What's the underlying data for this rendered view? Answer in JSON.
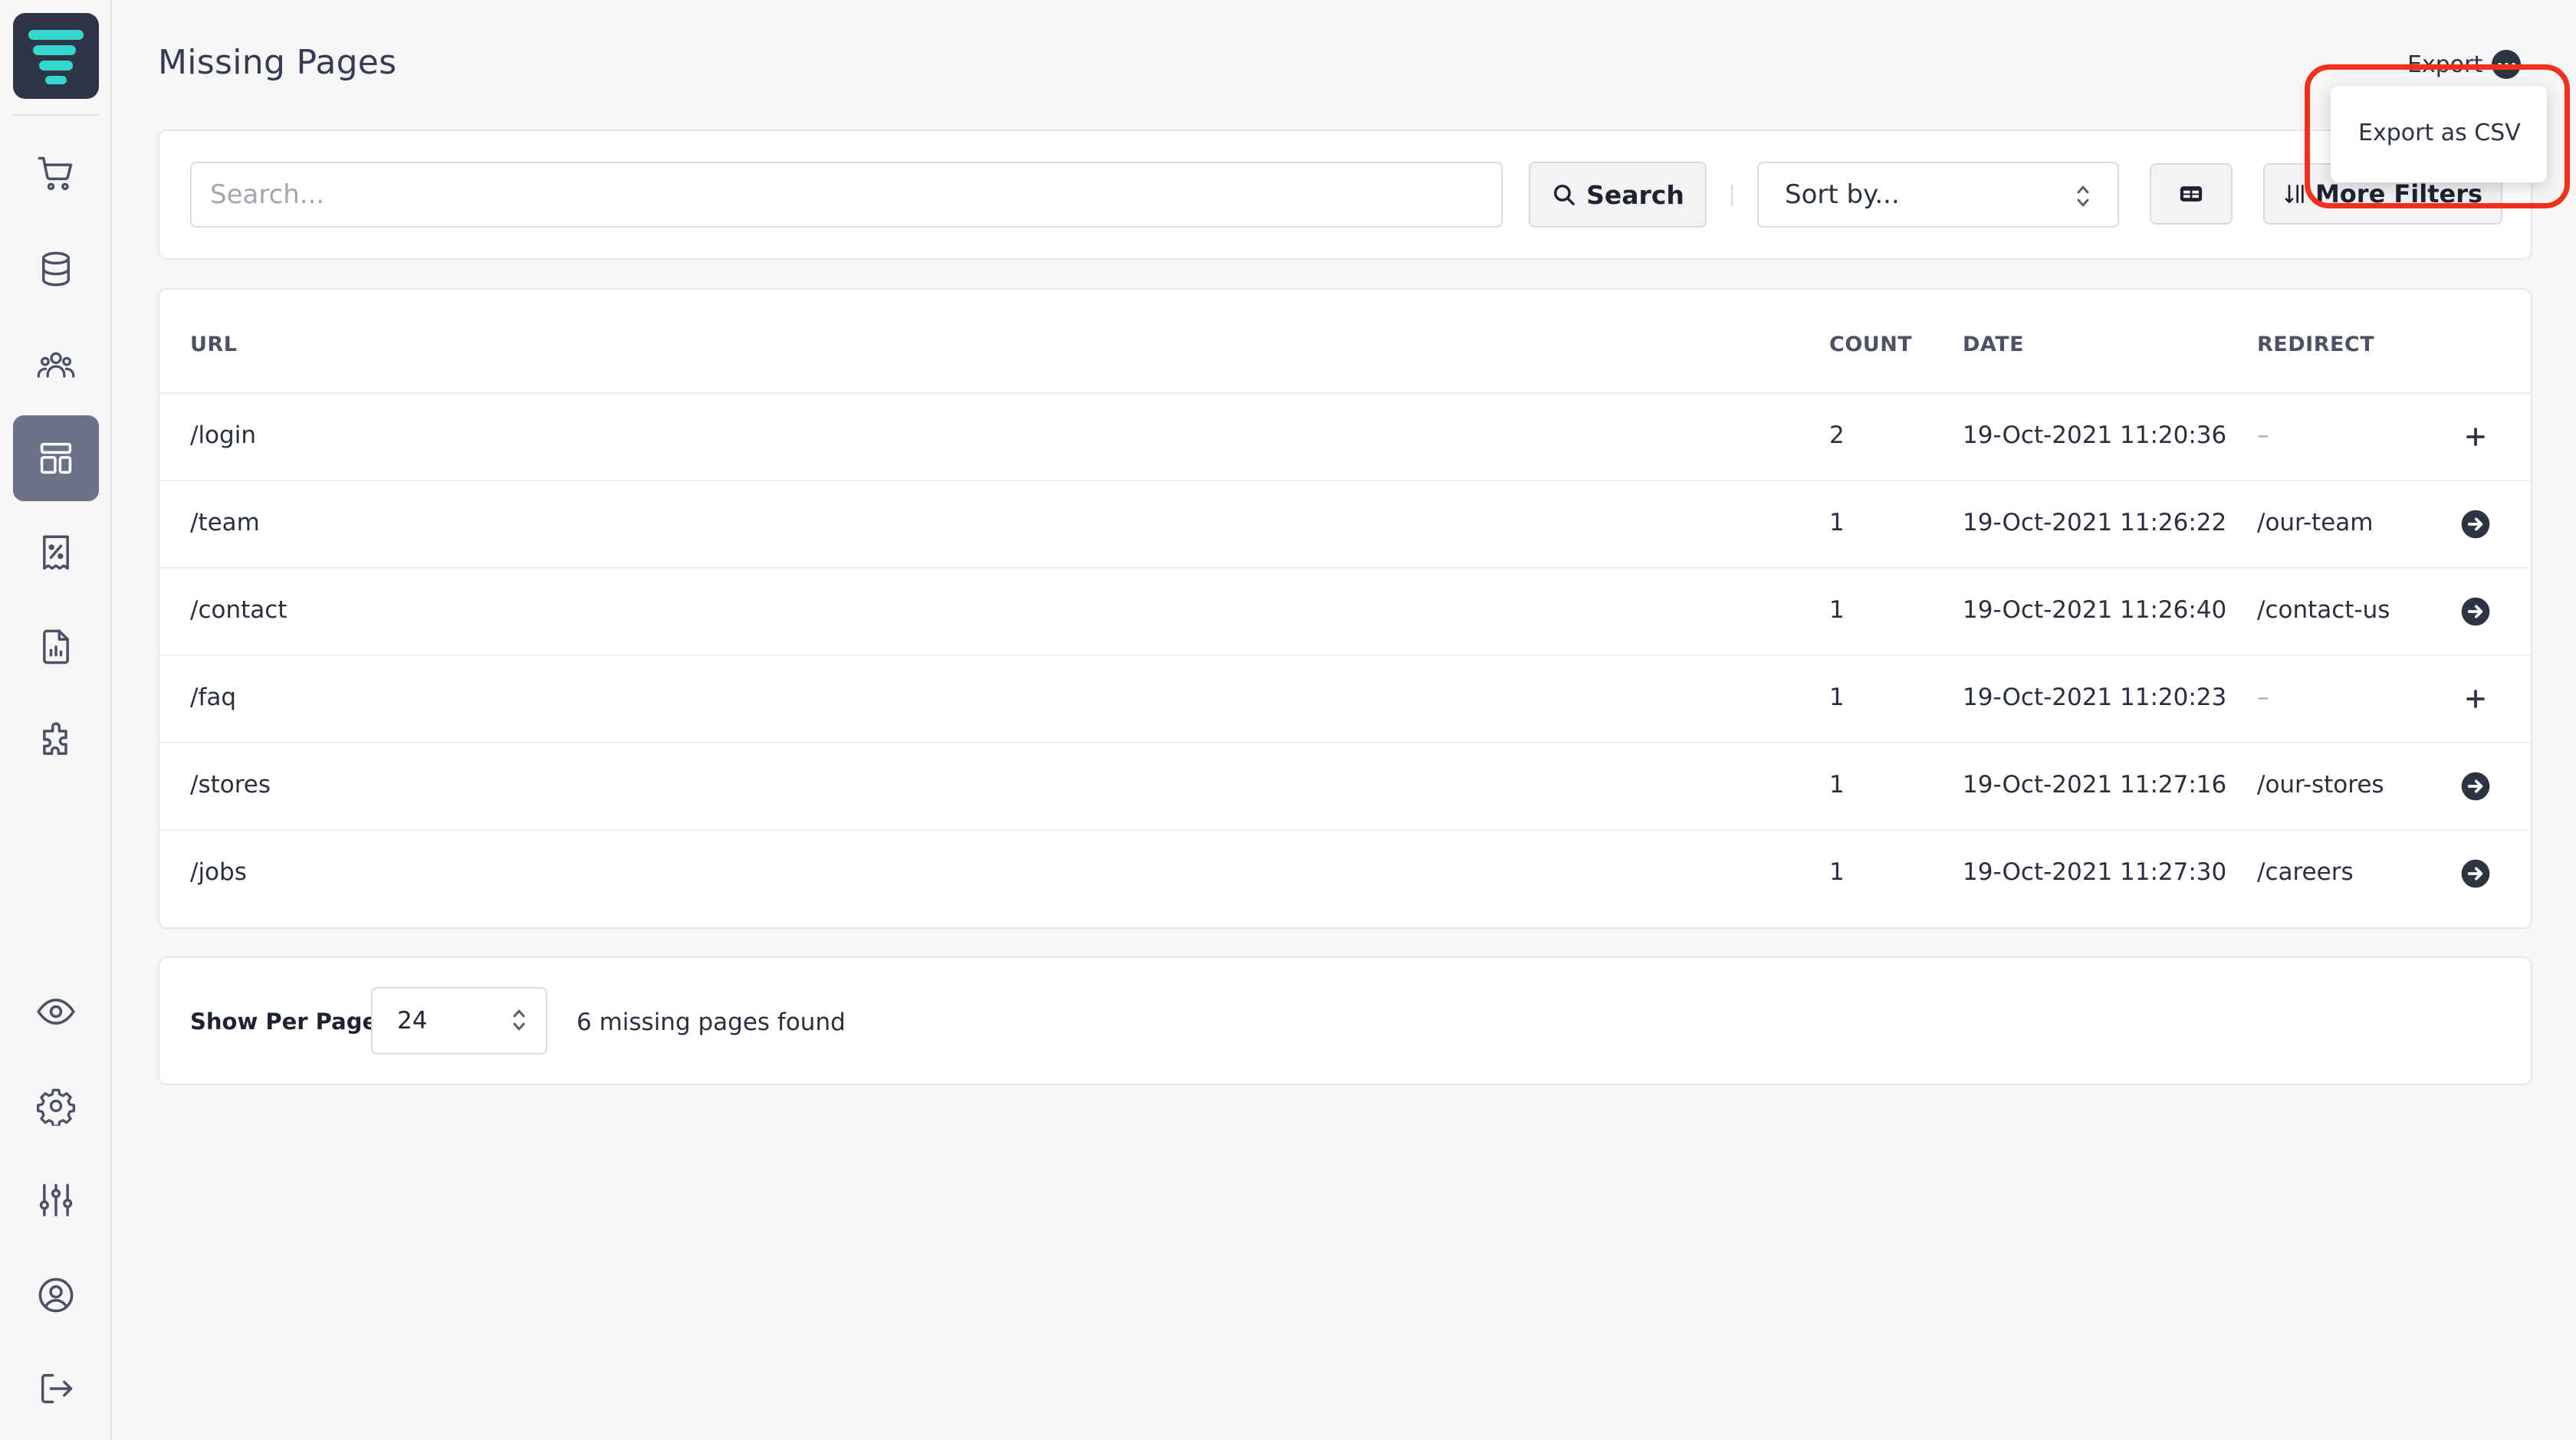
{
  "page": {
    "title": "Missing Pages"
  },
  "header": {
    "export_label": "Export"
  },
  "export_menu": {
    "items": [
      "Export as CSV"
    ]
  },
  "toolbar": {
    "search_placeholder": "Search...",
    "search_label": "Search",
    "sort_label": "Sort by...",
    "more_filters_label": "More Filters"
  },
  "sidebar": {
    "items": [
      {
        "name": "orders",
        "icon": "cart-icon"
      },
      {
        "name": "catalog",
        "icon": "database-icon"
      },
      {
        "name": "customers",
        "icon": "users-icon"
      },
      {
        "name": "content",
        "icon": "layout-icon",
        "active": true
      },
      {
        "name": "promotions",
        "icon": "discount-receipt-icon"
      },
      {
        "name": "reports",
        "icon": "report-icon"
      },
      {
        "name": "extensions",
        "icon": "puzzle-icon"
      },
      {
        "name": "preview",
        "icon": "eye-icon"
      },
      {
        "name": "settings",
        "icon": "gear-icon"
      },
      {
        "name": "configuration",
        "icon": "sliders-icon"
      },
      {
        "name": "account",
        "icon": "user-circle-icon"
      },
      {
        "name": "logout",
        "icon": "logout-icon"
      }
    ]
  },
  "table": {
    "headers": {
      "url": "URL",
      "count": "COUNT",
      "date": "DATE",
      "redirect": "REDIRECT"
    },
    "rows": [
      {
        "url": "/login",
        "count": "2",
        "date": "19-Oct-2021 11:20:36",
        "redirect": "–",
        "action": "plus-icon"
      },
      {
        "url": "/team",
        "count": "1",
        "date": "19-Oct-2021 11:26:22",
        "redirect": "/our-team",
        "action": "arrow-right-circle-icon"
      },
      {
        "url": "/contact",
        "count": "1",
        "date": "19-Oct-2021 11:26:40",
        "redirect": "/contact-us",
        "action": "arrow-right-circle-icon"
      },
      {
        "url": "/faq",
        "count": "1",
        "date": "19-Oct-2021 11:20:23",
        "redirect": "–",
        "action": "plus-icon"
      },
      {
        "url": "/stores",
        "count": "1",
        "date": "19-Oct-2021 11:27:16",
        "redirect": "/our-stores",
        "action": "arrow-right-circle-icon"
      },
      {
        "url": "/jobs",
        "count": "1",
        "date": "19-Oct-2021 11:27:30",
        "redirect": "/careers",
        "action": "arrow-right-circle-icon"
      }
    ]
  },
  "footer": {
    "per_page_label": "Show Per Page",
    "per_page_value": "24",
    "found_text": "6 missing pages found"
  },
  "colors": {
    "accent": "#2e3547",
    "logo_stripes": "#35d6d0",
    "active_nav": "#6b7287",
    "highlight": "#f2301b"
  }
}
